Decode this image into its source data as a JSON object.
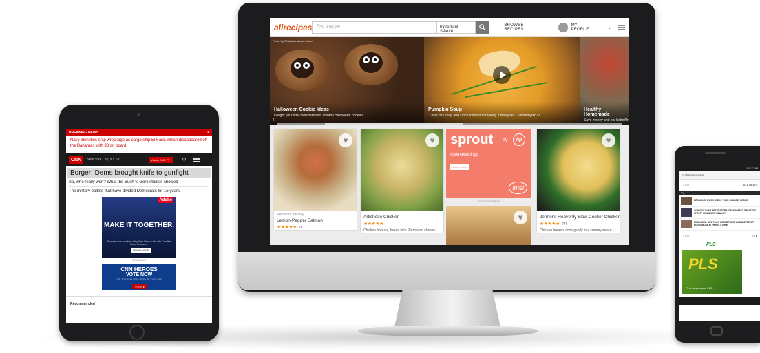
{
  "desktop": {
    "header": {
      "logo": "allrecipes",
      "search_placeholder": "Find a recipe",
      "ingredient_search": "Ingredient Search",
      "browse": "BROWSE RECIPES",
      "profile": "MY PROFILE"
    },
    "carousel": [
      {
        "credit": "Photo by What's for dinner Mom?",
        "title": "Halloween Cookie Ideas",
        "subtitle": "Delight your little monsters with colorful Halloween cookies."
      },
      {
        "credit": "",
        "title": "Pumpkin Soup",
        "subtitle": "\"I love this soup and I look forward to making it every fall.\" - mommyrkb23"
      },
      {
        "credit": "",
        "title": "Healthy Homemade",
        "subtitle": "Save money and eat better from"
      }
    ],
    "cards": [
      {
        "tag": "Recipe of the Day",
        "title": "Lemon-Pepper Salmon",
        "stars": "★★★★★",
        "count": "28",
        "desc": ""
      },
      {
        "tag": "",
        "title": "Artichoke Chicken",
        "stars": "★★★★★",
        "count": "",
        "desc": "Chicken breasts, baked with Parmesan cheese"
      },
      {
        "tag": "",
        "title": "Jenner's Heavenly Slow Cooker Chicken",
        "stars": "★★★★★",
        "count": "276",
        "desc": "Chicken breasts cook gently in a creamy sauce"
      }
    ],
    "ad": {
      "brand": "sprout",
      "by": "by",
      "hp": "hp",
      "hashtag": "#gomakethings",
      "cta": "Learn More",
      "intel": "intel",
      "label": "ADVERTISEMENT"
    }
  },
  "tablet": {
    "breaking_label": "BREAKING NEWS",
    "close": "×",
    "breaking_text": "Navy identifies ship wreckage as cargo ship El Faro, which disappeared off the Bahamas with 33 on board.",
    "logo": "CNN",
    "location": "New York City, NY 62°",
    "live": "Watch CNN TV",
    "headline": "Borger: Dems brought knife to gunfight",
    "story1": "So, who really won? What the Bush v. Gore studies showed",
    "story2": "The military ballots that have divided Democrats for 15 years",
    "ad1": {
      "title": "MAKE IT TOGETHER.",
      "sub": "Discover how creatives bring their ideas to life with Creative Cloud for teams.",
      "btn": "LEARN MORE",
      "adobe": "Adobe",
      "label": "Advertisement"
    },
    "ad2": {
      "t1": "CNN HEROES",
      "t2": "VOTE NOW",
      "t3": "FOR THE 2015 CNN HERO OF THE YEAR",
      "btn": "VOTE ▸"
    },
    "recommended": "Recommended"
  },
  "phone": {
    "status": "12:17 PM",
    "url": "m.cbsnews.com",
    "bar_right": "ALL NEWS",
    "tv": "TV",
    "items": [
      "BREAKING: EVERYONE IS \"SICK SOURCE\" LEGGE",
      "\"NOBODY EVER RESTS STORE: DESIGN BEST GREATEST SPOTS\" 2020 A NEW REALITY",
      "EXCLUSIVE: NEW PLAN WITH BRYANT MAGARETTE HIT FOR SUNDAY AT PARKS STORE"
    ],
    "pls_label": "PLS",
    "pls_logo": "PLS",
    "pls_text": "Find now around PLS.",
    "pager": "1/2 ▸"
  }
}
